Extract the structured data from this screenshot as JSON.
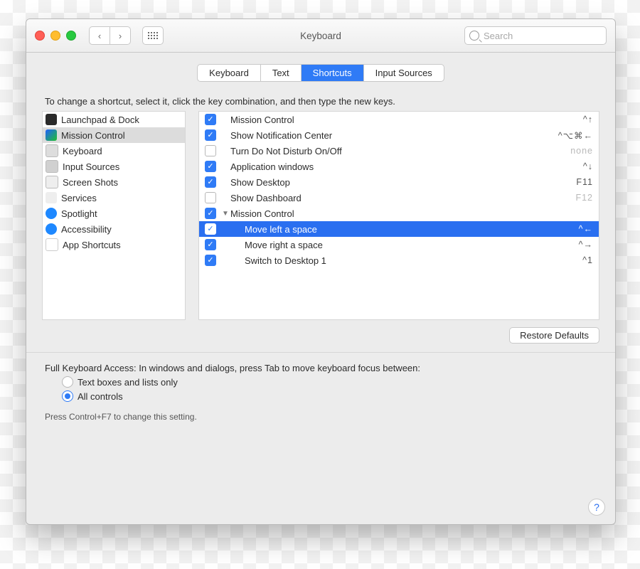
{
  "window": {
    "title": "Keyboard"
  },
  "toolbar": {
    "search_placeholder": "Search",
    "back_glyph": "‹",
    "fwd_glyph": "›"
  },
  "tabs": [
    {
      "label": "Keyboard",
      "active": false
    },
    {
      "label": "Text",
      "active": false
    },
    {
      "label": "Shortcuts",
      "active": true
    },
    {
      "label": "Input Sources",
      "active": false
    }
  ],
  "instruction": "To change a shortcut, select it, click the key combination, and then type the new keys.",
  "categories": [
    {
      "icon": "launchpad",
      "label": "Launchpad & Dock",
      "selected": false
    },
    {
      "icon": "mc",
      "label": "Mission Control",
      "selected": true
    },
    {
      "icon": "kb",
      "label": "Keyboard",
      "selected": false
    },
    {
      "icon": "inp",
      "label": "Input Sources",
      "selected": false
    },
    {
      "icon": "ss",
      "label": "Screen Shots",
      "selected": false
    },
    {
      "icon": "svc",
      "label": "Services",
      "selected": false
    },
    {
      "icon": "spot",
      "label": "Spotlight",
      "selected": false
    },
    {
      "icon": "acc",
      "label": "Accessibility",
      "selected": false
    },
    {
      "icon": "app",
      "label": "App Shortcuts",
      "selected": false
    }
  ],
  "shortcuts": [
    {
      "checked": true,
      "indent": 0,
      "disclose": "",
      "label": "Mission Control",
      "keys": "^↑",
      "dim": false,
      "selected": false
    },
    {
      "checked": true,
      "indent": 0,
      "disclose": "",
      "label": "Show Notification Center",
      "keys": "^⌥⌘←",
      "dim": false,
      "selected": false
    },
    {
      "checked": false,
      "indent": 0,
      "disclose": "",
      "label": "Turn Do Not Disturb On/Off",
      "keys": "none",
      "dim": true,
      "selected": false
    },
    {
      "checked": true,
      "indent": 0,
      "disclose": "",
      "label": "Application windows",
      "keys": "^↓",
      "dim": false,
      "selected": false
    },
    {
      "checked": true,
      "indent": 0,
      "disclose": "",
      "label": "Show Desktop",
      "keys": "F11",
      "dim": false,
      "selected": false
    },
    {
      "checked": false,
      "indent": 0,
      "disclose": "",
      "label": "Show Dashboard",
      "keys": "F12",
      "dim": true,
      "selected": false
    },
    {
      "checked": true,
      "indent": 0,
      "disclose": "▼",
      "label": "Mission Control",
      "keys": "",
      "dim": false,
      "selected": false
    },
    {
      "checked": true,
      "indent": 1,
      "disclose": "",
      "label": "Move left a space",
      "keys": "^←",
      "dim": false,
      "selected": true
    },
    {
      "checked": true,
      "indent": 1,
      "disclose": "",
      "label": "Move right a space",
      "keys": "^→",
      "dim": false,
      "selected": false
    },
    {
      "checked": true,
      "indent": 1,
      "disclose": "",
      "label": "Switch to Desktop 1",
      "keys": "^1",
      "dim": false,
      "selected": false
    }
  ],
  "restore_label": "Restore Defaults",
  "fka": {
    "heading": "Full Keyboard Access: In windows and dialogs, press Tab to move keyboard focus between:",
    "opt1": "Text boxes and lists only",
    "opt2": "All controls",
    "selected": 1
  },
  "hint": "Press Control+F7 to change this setting.",
  "help_glyph": "?"
}
